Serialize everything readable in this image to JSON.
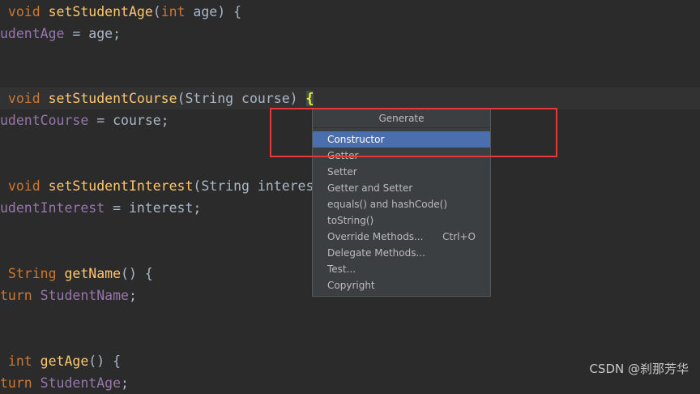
{
  "code": {
    "l1": {
      "t1": " void ",
      "t2": "setStudentAge",
      "t3": "(",
      "t4": "int",
      "t5": " age) {"
    },
    "l2": {
      "t1": "udentAge",
      "t2": " = age;"
    },
    "l3": {
      "t1": " void ",
      "t2": "setStudentCourse",
      "t3": "(String course) ",
      "t4": "{"
    },
    "l4": {
      "t1": "udentCourse",
      "t2": " = course;"
    },
    "l5": {
      "t1": " void ",
      "t2": "setStudentInterest",
      "t3": "(String interes"
    },
    "l6": {
      "t1": "udentInterest",
      "t2": " = interest;"
    },
    "l7": {
      "t1": " String ",
      "t2": "getName",
      "t3": "() {"
    },
    "l8": {
      "t1": "turn ",
      "t2": "StudentName",
      "t3": ";"
    },
    "l9": {
      "t1": " int ",
      "t2": "getAge",
      "t3": "() {"
    },
    "l10": {
      "t1": "turn ",
      "t2": "StudentAge",
      "t3": ";"
    }
  },
  "generate_menu": {
    "title": "Generate",
    "items": [
      {
        "label": "Constructor",
        "shortcut": ""
      },
      {
        "label": "Getter",
        "shortcut": ""
      },
      {
        "label": "Setter",
        "shortcut": ""
      },
      {
        "label": "Getter and Setter",
        "shortcut": ""
      },
      {
        "label": "equals() and hashCode()",
        "shortcut": ""
      },
      {
        "label": "toString()",
        "shortcut": ""
      },
      {
        "label": "Override Methods...",
        "shortcut": "Ctrl+O"
      },
      {
        "label": "Delegate Methods...",
        "shortcut": ""
      },
      {
        "label": "Test...",
        "shortcut": ""
      },
      {
        "label": "Copyright",
        "shortcut": ""
      }
    ],
    "selected_index": 0
  },
  "watermark": "CSDN @刹那芳华⁠",
  "colors": {
    "background": "#2b2b2b",
    "keyword": "#cc7832",
    "method": "#ffc66d",
    "field": "#9876aa",
    "selection": "#4b6eaf",
    "annotation_box": "#e53935"
  }
}
